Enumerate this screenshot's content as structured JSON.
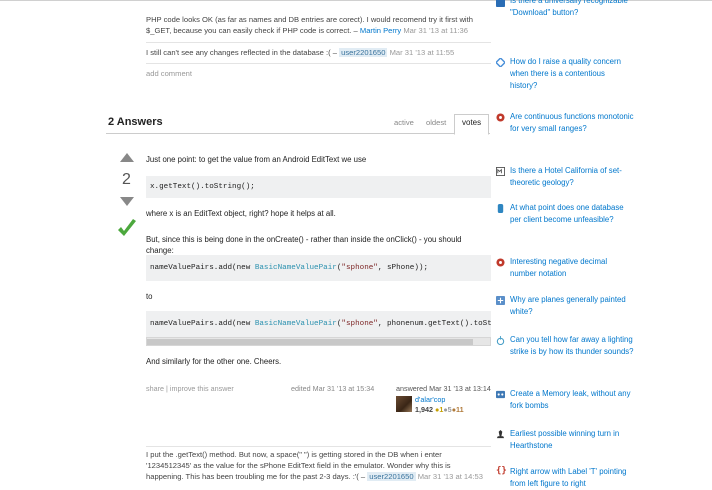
{
  "question_comments": [
    {
      "text": "PHP code looks OK (as far as names and DB entries are corect). I would recomend try it first with $_GET, because you can easily check if PHP code is correct. –",
      "user": "Martin Perry",
      "time": "Mar 31 '13 at 11:36"
    },
    {
      "text": "I still can't see any changes reflected in the database :( –",
      "user": "user2201650",
      "time": "Mar 31 '13 at 11:55"
    }
  ],
  "add_comment": "add comment",
  "answers": {
    "title": "2 Answers",
    "tabs": [
      "active",
      "oldest",
      "votes"
    ],
    "selected_tab": "votes"
  },
  "answer": {
    "votes": "2",
    "p1": "Just one point: to get the value from an Android EditText we use",
    "code1": "x.getText().toString();",
    "p2": "where x is an EditText object, right? hope it helps at all.",
    "p3": "But, since this is being done in the onCreate() - rather than inside the onClick() - you should change:",
    "code2": {
      "pre": "nameValuePairs.add(new ",
      "type": "BasicNameValuePair",
      "mid": "(",
      "str": "\"sphone\"",
      "post": ", sPhone));"
    },
    "p4": "to",
    "code3": {
      "pre": "nameValuePairs.add(new ",
      "type": "BasicNameValuePair",
      "mid": "(",
      "str": "\"sphone\"",
      "post": ", phonenum.getText().toString())"
    },
    "p5": "And similarly for the other one. Cheers.",
    "share": "share",
    "improve": "improve this answer",
    "edited": "edited Mar 31 '13 at 15:34",
    "answered": "answered Mar 31 '13 at 13:14",
    "user": "d'alar'cop",
    "rep": "1,942",
    "badge_gold": "●1",
    "badge_silver": "●5",
    "badge_bronze": "●11",
    "scroll_fraction": 0.95
  },
  "answer_comment": {
    "text": "I put the .getText() method. But now, a space(\" \") is getting stored in the DB when i enter '1234512345' as the value for the sPhone EditText field in the emulator. Wonder why this is happening. This has been troubling me for the past 2-3 days. :'( –",
    "user": "user2201650",
    "time": "Mar 31 '13 at 14:53"
  },
  "sidebar": {
    "items": [
      {
        "icon": "ux-icon",
        "color": "#2a6db5",
        "text": "Is there a universally recognizable \"Download\" button?"
      },
      {
        "icon": "diamond-icon",
        "color": "#4a90d9",
        "text": "How do I raise a quality concern when there is a contentious history?"
      },
      {
        "icon": "gear-icon",
        "color": "#c0392b",
        "text": "Are continuous functions monotonic for very small ranges?"
      },
      {
        "icon": "mo-icon",
        "color": "#555555",
        "text": "Is there a Hotel California of set-theoretic geology?"
      },
      {
        "icon": "database-icon",
        "color": "#2e86c1",
        "text": "At what point does one database per client become unfeasible?"
      },
      {
        "icon": "gear-icon",
        "color": "#c0392b",
        "text": "Interesting negative decimal number notation"
      },
      {
        "icon": "square-icon",
        "color": "#5b8fc9",
        "text": "Why are planes generally painted white?"
      },
      {
        "icon": "physics-icon",
        "color": "#4aa0c8",
        "text": "Can you tell how far away a lighting strike is by how its thunder sounds?"
      },
      {
        "icon": "codegolf-icon",
        "color": "#3f79b5",
        "text": "Create a Memory leak, without any fork bombs"
      },
      {
        "icon": "chess-icon",
        "color": "#333333",
        "text": "Earliest possible winning turn in Hearthstone"
      },
      {
        "icon": "brackets-icon",
        "color": "#c0392b",
        "text": "Right arrow with Label 'T' pointing from left figure to right"
      }
    ]
  }
}
